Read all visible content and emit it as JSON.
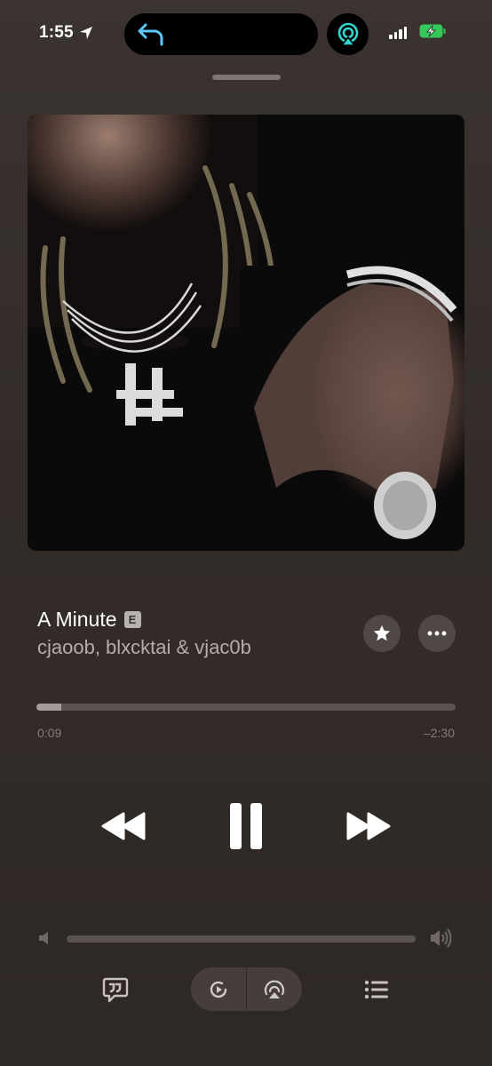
{
  "status_bar": {
    "time": "1:55",
    "icons": [
      "location-arrow-icon",
      "back-arrow-icon",
      "airplay-icon",
      "cellular-signal-icon",
      "battery-charging-icon"
    ],
    "accent_color": "#5ac8fa",
    "battery_color": "#34c759"
  },
  "now_playing": {
    "title": "A Minute",
    "explicit_badge": "E",
    "artist": "cjaoob, blxcktai & vjac0b",
    "elapsed": "0:09",
    "remaining": "–2:30",
    "progress_fraction": 0.06,
    "volume_fraction": 0.0,
    "state": "playing"
  },
  "buttons": {
    "favorite": "star-icon",
    "more": "ellipsis-icon",
    "previous": "rewind-icon",
    "pause": "pause-icon",
    "next": "fast-forward-icon"
  },
  "bottom_bar": {
    "lyrics": "lyrics-quote-icon",
    "autoplay": "autoplay-icon",
    "airplay": "airplay-icon",
    "queue": "queue-list-icon"
  }
}
